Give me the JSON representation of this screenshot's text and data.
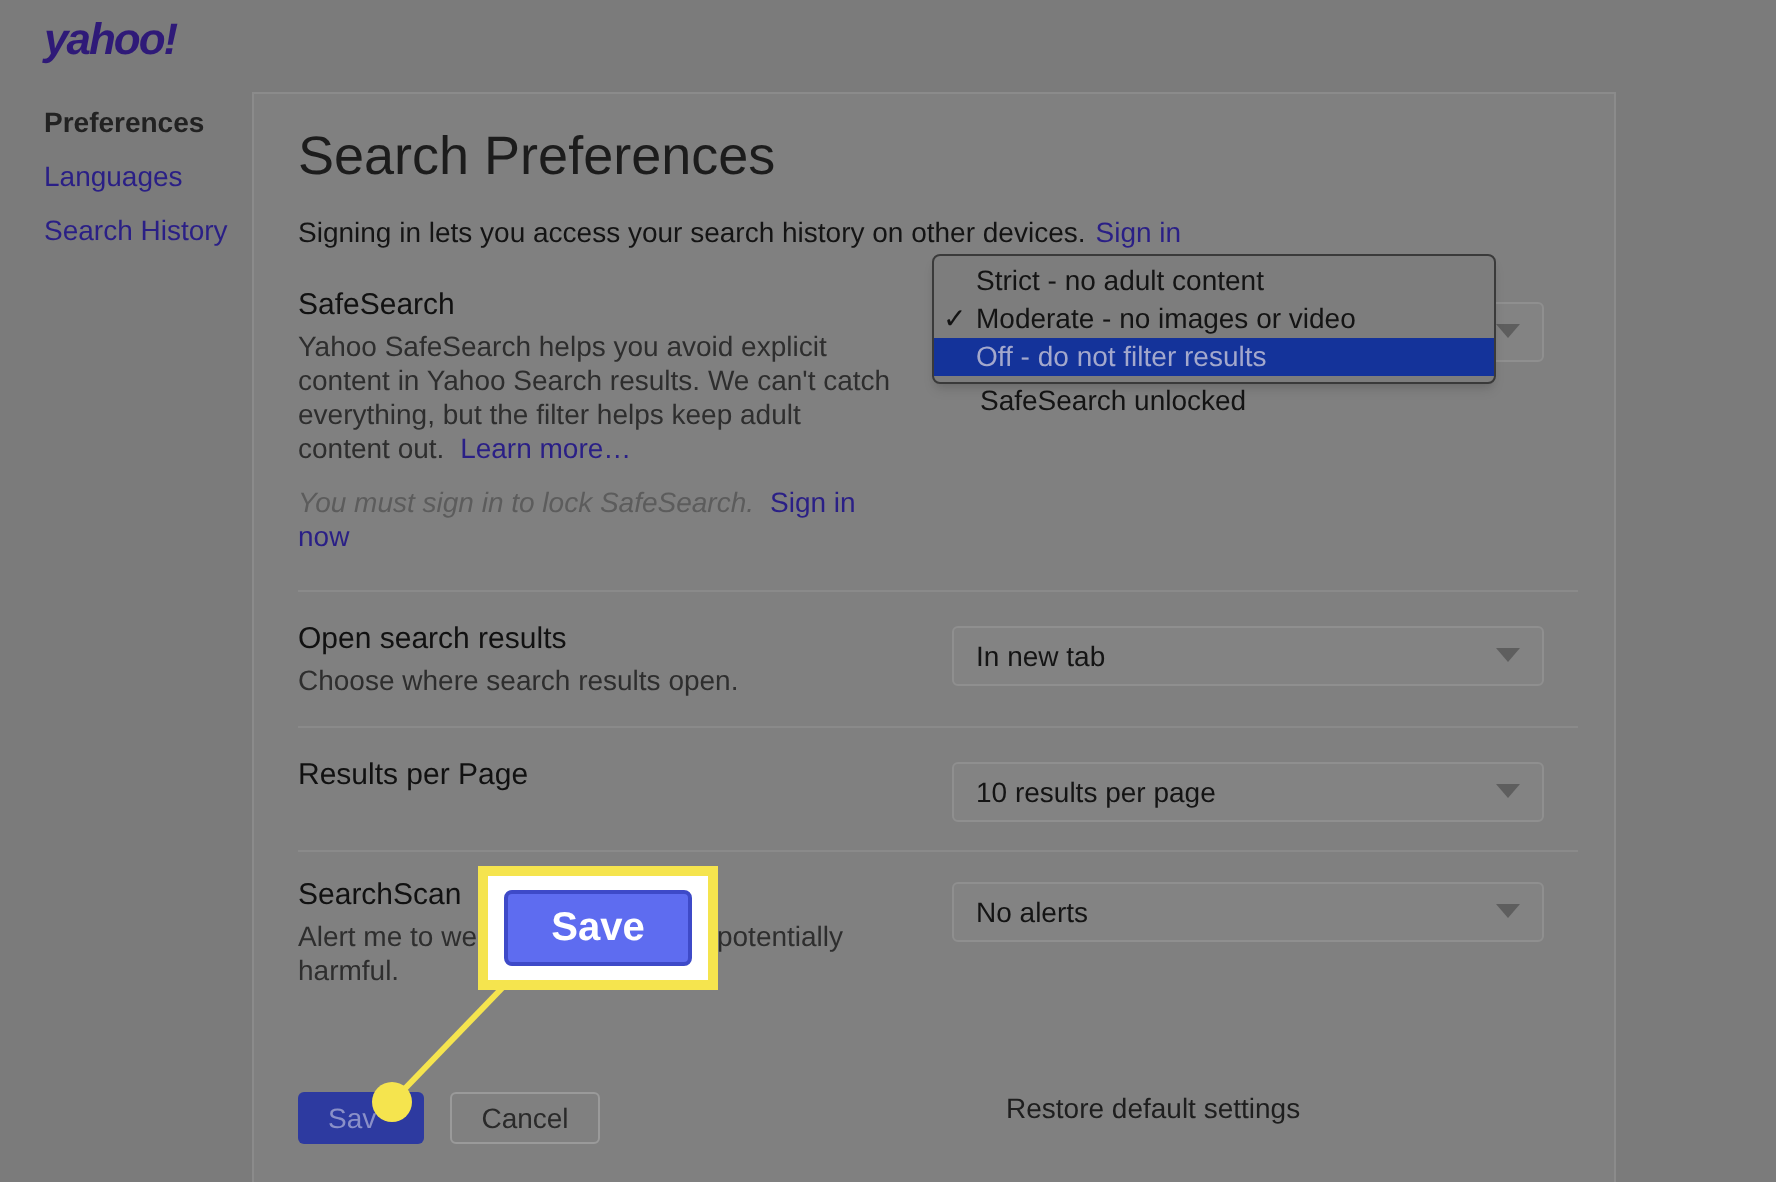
{
  "logo": "yahoo!",
  "sidebar": {
    "items": [
      {
        "label": "Preferences",
        "selected": true
      },
      {
        "label": "Languages",
        "selected": false
      },
      {
        "label": "Search History",
        "selected": false
      }
    ]
  },
  "panel": {
    "title": "Search Preferences",
    "signin_note": {
      "text": "Signing in lets you access your search history on other devices.",
      "link": "Sign in"
    },
    "settings": [
      {
        "kind": "safesearch",
        "label": "SafeSearch",
        "description": "Yahoo SafeSearch helps you avoid explicit content in Yahoo Search results. We can't catch everything, but the filter helps keep adult content out.",
        "learn_more": "Learn more…",
        "lock_note": "You must sign in to lock SafeSearch.",
        "lock_link_lines": [
          "Sign in",
          "now"
        ],
        "status": "SafeSearch unlocked",
        "menu": [
          {
            "label": "Strict - no adult content",
            "selected": false
          },
          {
            "label": "Moderate - no images or video",
            "check": "✓",
            "selected": false
          },
          {
            "label": "Off - do not filter results",
            "selected": true
          }
        ]
      },
      {
        "kind": "select",
        "label": "Open search results",
        "description": "Choose where search results open.",
        "value": "In new tab"
      },
      {
        "kind": "select",
        "label": "Results per Page",
        "value": "10 results per page"
      },
      {
        "kind": "covered",
        "label": "SearchScan",
        "description_parts": [
          "Alert me to we",
          "potentially",
          "harmful."
        ],
        "value": "No alerts"
      }
    ]
  },
  "actions": {
    "save": "Sav",
    "cancel": "Cancel",
    "restore": "Restore default settings"
  },
  "callout": {
    "label": "Save"
  }
}
